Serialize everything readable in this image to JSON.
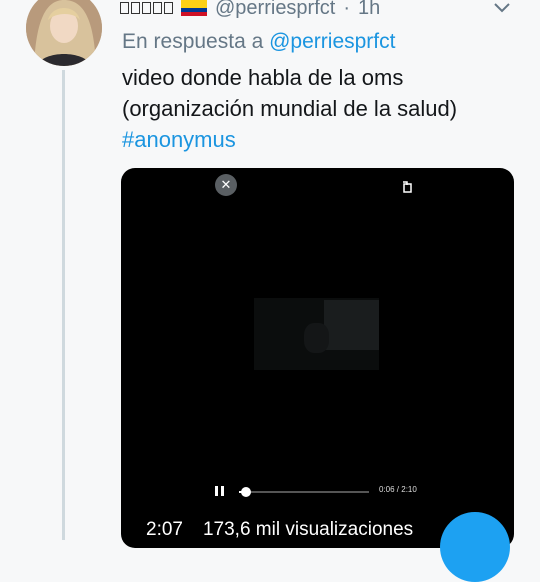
{
  "tweet": {
    "handle": "@perriesprfct",
    "separator": "·",
    "age": "1h",
    "reply_prefix": "En respuesta a",
    "reply_to": "@perriesprfct",
    "text_line1": "video donde habla de  la oms",
    "text_line2": "(organización mundial de la salud)",
    "hashtag": "#anonymus",
    "name_flag": "colombia-flag-icon"
  },
  "video": {
    "current_time_small": "0:06 / 2:10",
    "progress": 0.05,
    "duration": "2:07",
    "views": "173,6 mil visualizaciones"
  },
  "colors": {
    "link": "#1b95e0",
    "secondary": "#657786",
    "fab": "#1da1f2"
  }
}
